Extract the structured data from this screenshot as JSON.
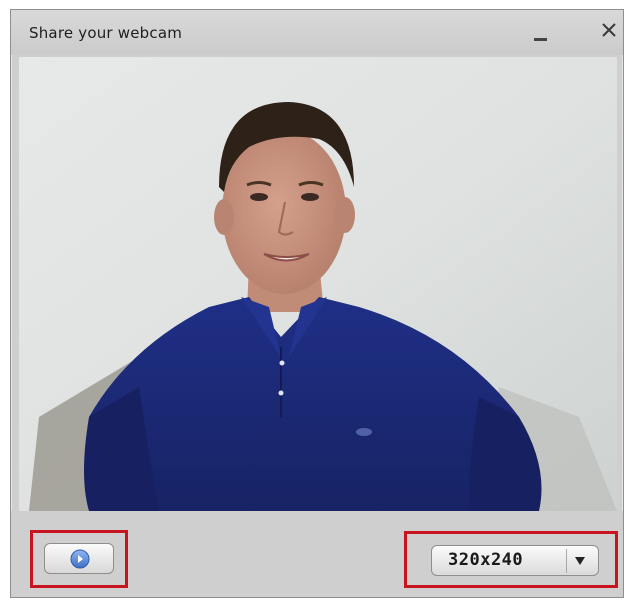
{
  "window": {
    "title": "Share your webcam"
  },
  "controls": {
    "resolution": {
      "selected": "320x240"
    }
  },
  "icons": {
    "minimize": "minimize-icon",
    "close": "close-icon",
    "play": "play-icon",
    "dropdown": "chevron-down-icon"
  },
  "colors": {
    "highlight": "#c8141e",
    "shirt": "#1c2a78"
  }
}
